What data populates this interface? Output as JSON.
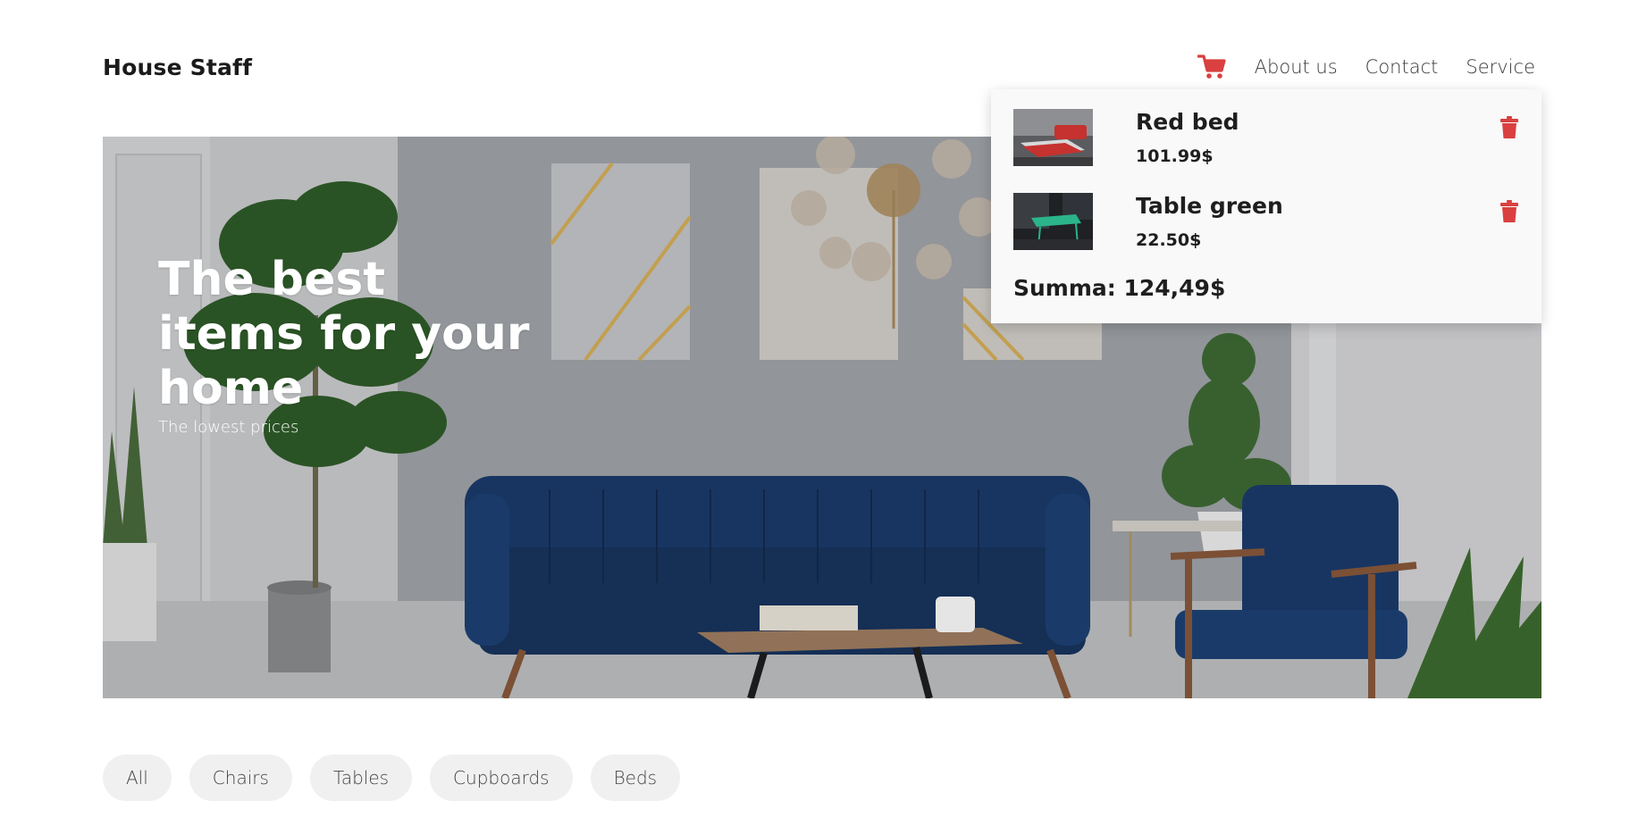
{
  "header": {
    "logo": "House Staff",
    "nav": {
      "cart_icon": "shopping-cart-icon",
      "about": "About us",
      "contact": "Contact",
      "service": "Service"
    }
  },
  "hero": {
    "title": "The best items for your home",
    "subtitle": "The lowest prices"
  },
  "cart": {
    "items": [
      {
        "name": "Red bed",
        "price": "101.99$",
        "thumb": "red-bed-photo",
        "delete_icon": "trash-icon"
      },
      {
        "name": "Table green",
        "price": "22.50$",
        "thumb": "green-table-photo",
        "delete_icon": "trash-icon"
      }
    ],
    "total": "Summa: 124,49$"
  },
  "filters": [
    "All",
    "Chairs",
    "Tables",
    "Cupboards",
    "Beds"
  ],
  "colors": {
    "accent": "#d9403f",
    "text": "#1e1e1e",
    "filter_bg": "#f0f0f0",
    "panel_bg": "#f9f9f9",
    "sofa": "#1b3c6e"
  }
}
